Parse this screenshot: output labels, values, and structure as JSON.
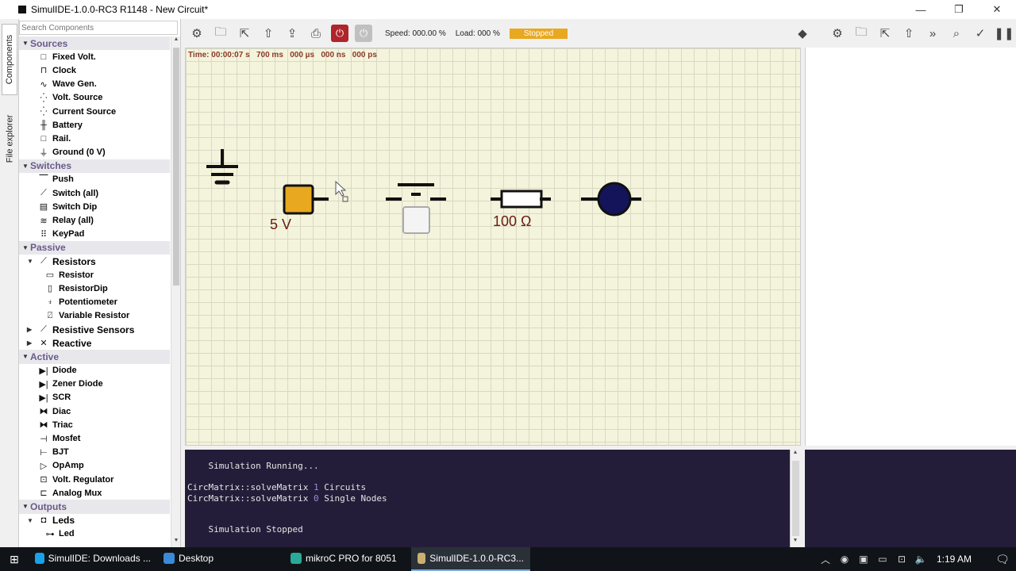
{
  "window": {
    "title": "SimulIDE-1.0.0-RC3 R1148 - New Circuit*",
    "minimize": "—",
    "maximize": "❐",
    "close": "✕"
  },
  "vtabs": {
    "components": "Components",
    "file_explorer": "File explorer"
  },
  "component_panel": {
    "search_placeholder": "Search Components",
    "rows": [
      {
        "kind": "cat",
        "label": "Sources",
        "icon": "▼"
      },
      {
        "kind": "item",
        "label": "Fixed Volt.",
        "icon": "□"
      },
      {
        "kind": "item",
        "label": "Clock",
        "icon": "⊓"
      },
      {
        "kind": "item",
        "label": "Wave Gen.",
        "icon": "∿"
      },
      {
        "kind": "item",
        "label": "Volt. Source",
        "icon": "⁛"
      },
      {
        "kind": "item",
        "label": "Current Source",
        "icon": "⁛"
      },
      {
        "kind": "item",
        "label": "Battery",
        "icon": "╫"
      },
      {
        "kind": "item",
        "label": "Rail.",
        "icon": "□"
      },
      {
        "kind": "item",
        "label": "Ground (0 V)",
        "icon": "⏚"
      },
      {
        "kind": "cat",
        "label": "Switches",
        "icon": "▼"
      },
      {
        "kind": "item",
        "label": "Push",
        "icon": "⎺"
      },
      {
        "kind": "item",
        "label": "Switch (all)",
        "icon": "⟋"
      },
      {
        "kind": "item",
        "label": "Switch Dip",
        "icon": "▤"
      },
      {
        "kind": "item",
        "label": "Relay (all)",
        "icon": "≋"
      },
      {
        "kind": "item",
        "label": "KeyPad",
        "icon": "⠿"
      },
      {
        "kind": "cat",
        "label": "Passive",
        "icon": "▼"
      },
      {
        "kind": "sub",
        "label": "Resistors",
        "icon": "⟋",
        "tri": "▼"
      },
      {
        "kind": "subitem",
        "label": "Resistor",
        "icon": "▭"
      },
      {
        "kind": "subitem",
        "label": "ResistorDip",
        "icon": "▯"
      },
      {
        "kind": "subitem",
        "label": "Potentiometer",
        "icon": "⍖"
      },
      {
        "kind": "subitem",
        "label": "Variable Resistor",
        "icon": "⍁"
      },
      {
        "kind": "sub",
        "label": "Resistive Sensors",
        "icon": "⟋",
        "tri": "▶"
      },
      {
        "kind": "sub",
        "label": "Reactive",
        "icon": "✕",
        "tri": "▶"
      },
      {
        "kind": "cat",
        "label": "Active",
        "icon": "▼"
      },
      {
        "kind": "item",
        "label": "Diode",
        "icon": "▶|"
      },
      {
        "kind": "item",
        "label": "Zener Diode",
        "icon": "▶|"
      },
      {
        "kind": "item",
        "label": "SCR",
        "icon": "▶|"
      },
      {
        "kind": "item",
        "label": "Diac",
        "icon": "⧓"
      },
      {
        "kind": "item",
        "label": "Triac",
        "icon": "⧓"
      },
      {
        "kind": "item",
        "label": "Mosfet",
        "icon": "⊣"
      },
      {
        "kind": "item",
        "label": "BJT",
        "icon": "⊢"
      },
      {
        "kind": "item",
        "label": "OpAmp",
        "icon": "▷"
      },
      {
        "kind": "item",
        "label": "Volt. Regulator",
        "icon": "⊡"
      },
      {
        "kind": "item",
        "label": "Analog Mux",
        "icon": "⊏"
      },
      {
        "kind": "cat",
        "label": "Outputs",
        "icon": "▼"
      },
      {
        "kind": "sub",
        "label": "Leds",
        "icon": "◘",
        "tri": "▼"
      },
      {
        "kind": "subitem",
        "label": "Led",
        "icon": "⊶"
      }
    ]
  },
  "toolbar": {
    "icons_left": [
      "gear-icon",
      "open-file-icon",
      "save-icon",
      "export-icon",
      "upload-icon",
      "print-icon"
    ],
    "power_on_icon": "⏻",
    "power_off_icon": "⏻",
    "speed": "Speed: 000.00 %",
    "load": "Load: 000 %",
    "status": "Stopped",
    "icons_right": [
      "diamond-icon",
      "gear-icon",
      "open-file-icon",
      "save-icon",
      "upload-icon",
      "chevron-right-icon",
      "search-icon",
      "check-icon",
      "pause-icon"
    ]
  },
  "canvas": {
    "time": "Time: 00:00:07 s   700 ms   000 µs   000 ns   000 ps",
    "fixed_volt_label": "5 V",
    "resistor_label": "100 Ω"
  },
  "console": {
    "lines": [
      {
        "text": "    Simulation Running...",
        "num": "",
        "rest": ""
      },
      {
        "text": "CircMatrix::solveMatrix ",
        "num": "1",
        "rest": " Circuits"
      },
      {
        "text": "CircMatrix::solveMatrix ",
        "num": "0",
        "rest": " Single Nodes"
      },
      {
        "text": "    Simulation Stopped",
        "num": "",
        "rest": ""
      }
    ]
  },
  "taskbar": {
    "tasks": [
      {
        "label": "SimulIDE: Downloads ...",
        "color": "#1aa1e8"
      },
      {
        "label": "Desktop",
        "color": "#3a8ad8"
      },
      {
        "label": "mikroC PRO for 8051",
        "color": "#2aa89a"
      },
      {
        "label": "SimulIDE-1.0.0-RC3...",
        "color": "#c8b070"
      }
    ],
    "clock": "1:19 AM"
  },
  "colors": {
    "accent_power": "#b0242b",
    "status_badge": "#e8a820",
    "canvas_bg": "#f4f4dc",
    "console_bg": "#241d3a",
    "category_text": "#6a5a8a"
  }
}
